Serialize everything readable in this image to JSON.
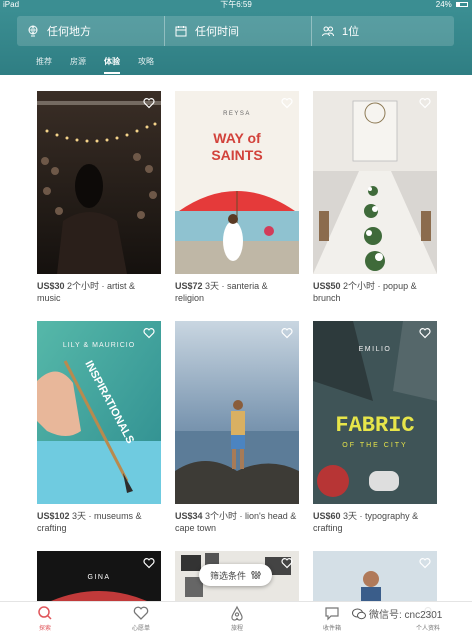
{
  "status_bar": {
    "device": "iPad",
    "time": "下午6:59",
    "battery": "24%"
  },
  "search": {
    "location": "任何地方",
    "time": "任何时间",
    "guests": "1位"
  },
  "tabs": [
    {
      "label": "推荐"
    },
    {
      "label": "房源"
    },
    {
      "label": "体验"
    },
    {
      "label": "攻略"
    }
  ],
  "cards": [
    {
      "price": "US$30",
      "details": "2个小时 · artist & music"
    },
    {
      "price": "US$72",
      "details": "3天 · santeria & religion",
      "image_text": {
        "brand": "REYSA",
        "title_top": "WAY of",
        "title_bottom": "SAINTS"
      }
    },
    {
      "price": "US$50",
      "details": "2个小时 · popup & brunch"
    },
    {
      "price": "US$102",
      "details": "3天 · museums & crafting",
      "image_text": {
        "names": "LILY & MAURICIO",
        "word": "INSPIRATIONALS"
      }
    },
    {
      "price": "US$34",
      "details": "3个小时 · lion's head & cape town"
    },
    {
      "price": "US$60",
      "details": "3天 · typography & crafting",
      "image_text": {
        "brand": "EMILIO",
        "title": "FABRIC",
        "subtitle": "OF THE CITY"
      }
    },
    {
      "image_text": {
        "name": "GINA"
      }
    },
    {},
    {}
  ],
  "filter_button": {
    "label": "筛选条件"
  },
  "bottom_nav": [
    {
      "label": "探索"
    },
    {
      "label": "心愿单"
    },
    {
      "label": "旅程"
    },
    {
      "label": "收件箱"
    },
    {
      "label": "个人资料"
    }
  ],
  "watermark": {
    "text": "微信号: cnc2301"
  },
  "colors": {
    "header": "#3b8e92",
    "accent": "#e0565b",
    "text": "#484848"
  }
}
